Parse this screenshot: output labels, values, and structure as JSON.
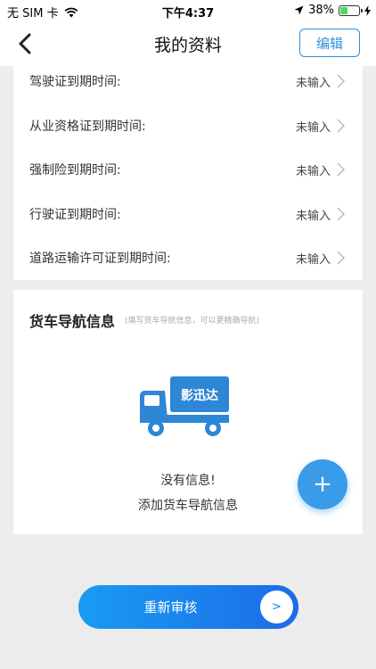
{
  "status_bar": {
    "carrier": "无 SIM 卡",
    "time": "下午4:37",
    "battery": "38%",
    "battery_level": 0.38
  },
  "header": {
    "title": "我的资料",
    "edit_label": "编辑"
  },
  "fields": [
    {
      "label": "驾驶证到期时间:",
      "value": "未输入"
    },
    {
      "label": "从业资格证到期时间:",
      "value": "未输入"
    },
    {
      "label": "强制险到期时间:",
      "value": "未输入"
    },
    {
      "label": "行驶证到期时间:",
      "value": "未输入"
    },
    {
      "label": "道路运输许可证到期时间:",
      "value": "未输入"
    }
  ],
  "truck_nav": {
    "title": "货车导航信息",
    "hint": "(填写货车导航信息，可以更精确导航)",
    "truck_brand": "影迅达",
    "empty_text": "没有信息!",
    "add_text": "添加货车导航信息",
    "add_button": "+"
  },
  "footer": {
    "resubmit_label": "重新审核",
    "arrow_label": ">"
  },
  "colors": {
    "accent": "#2f8fe0",
    "fab": "#3a9be8",
    "battery": "#4cd964"
  }
}
